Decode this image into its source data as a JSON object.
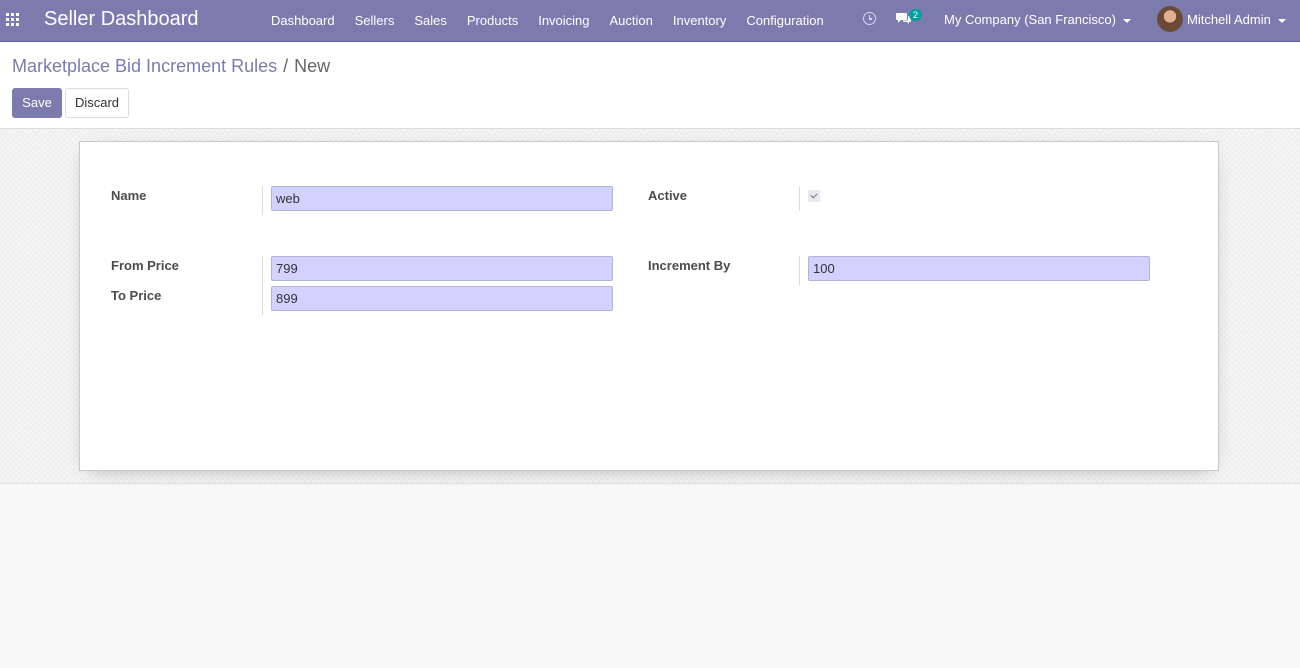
{
  "navbar": {
    "brand": "Seller Dashboard",
    "menu": [
      "Dashboard",
      "Sellers",
      "Sales",
      "Products",
      "Invoicing",
      "Auction",
      "Inventory",
      "Configuration"
    ],
    "chat_count": "2",
    "company": "My Company (San Francisco)",
    "user": "Mitchell Admin",
    "color": "#7c7bad"
  },
  "breadcrumb": {
    "parent": "Marketplace Bid Increment Rules",
    "separator": "/",
    "current": "New"
  },
  "actions": {
    "save_label": "Save",
    "discard_label": "Discard"
  },
  "form": {
    "name_label": "Name",
    "name_value": "web",
    "active_label": "Active",
    "active_checked": true,
    "from_price_label": "From Price",
    "from_price_value": "799",
    "to_price_label": "To Price",
    "to_price_value": "899",
    "increment_label": "Increment By",
    "increment_value": "100"
  }
}
